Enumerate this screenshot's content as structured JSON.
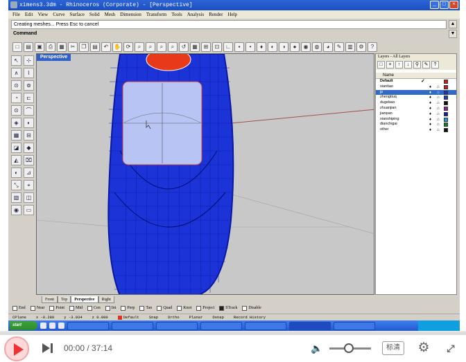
{
  "window": {
    "title": "ximens3.3dm - Rhinoceros (Corporate) - [Perspective]",
    "controls": [
      "_",
      "□",
      "×"
    ]
  },
  "menu": [
    "File",
    "Edit",
    "View",
    "Curve",
    "Surface",
    "Solid",
    "Mesh",
    "Dimension",
    "Transform",
    "Tools",
    "Analysis",
    "Render",
    "Help"
  ],
  "command": {
    "history": "Creating meshes... Press Esc to cancel",
    "prompt": "Command"
  },
  "toolbar_icons": [
    "new-file-icon",
    "open-icon",
    "save-icon",
    "print-icon",
    "import-icon",
    "cut-icon",
    "copy-icon",
    "paste-icon",
    "undo-icon",
    "pan-icon",
    "rotate-view-icon",
    "zoom-window-icon",
    "zoom-dynamic-icon",
    "zoom-extents-icon",
    "zoom-selected-icon",
    "undo-view-icon",
    "four-views-icon",
    "grid-icon",
    "cplane-icon",
    "ortho-icon",
    "snap-icon",
    "point-icon",
    "light-bulb-icon",
    "show-icon",
    "hide-icon",
    "shade-icon",
    "render-icon",
    "sphere-icon",
    "material-icon",
    "edit-icon",
    "layer-icon",
    "options-icon",
    "help-icon"
  ],
  "toolbar_glyphs": [
    "□",
    "▤",
    "▣",
    "⎙",
    "▦",
    "✂",
    "❐",
    "▤",
    "↶",
    "✋",
    "⟳",
    "⌕",
    "⌕",
    "⌕",
    "⌕",
    "↺",
    "▦",
    "⊞",
    "⊡",
    "∟",
    "▪",
    "•",
    "♦",
    "◐",
    "◑",
    "●",
    "◉",
    "◍",
    "◕",
    "✎",
    "▥",
    "⚙",
    "?"
  ],
  "left_tool_glyphs": [
    "↖",
    "⊹",
    "∧",
    "⌇",
    "⊙",
    "⊚",
    "◔",
    "⊏",
    "⊙",
    "⌒",
    "◈",
    "◐",
    "▦",
    "⊟",
    "◪",
    "◆",
    "◭",
    "⌧",
    "◐",
    "⊿",
    "⤡",
    "⌖",
    "▧",
    "◫",
    "◉",
    "▭"
  ],
  "viewport": {
    "title": "Perspective"
  },
  "view_tabs": [
    "Front",
    "Top",
    "Perspective",
    "Right"
  ],
  "view_tab_active": 2,
  "layers": {
    "title": "Layers - All Layers",
    "tool_glyphs": [
      "□",
      "×",
      "↑",
      "↓",
      "⚲",
      "✎",
      "?"
    ],
    "column_header": "Name",
    "rows": [
      {
        "name": "Default",
        "bold": true,
        "current": true,
        "selected": false,
        "color": "#c82020"
      },
      {
        "name": "xiantiao",
        "bold": false,
        "current": false,
        "selected": false,
        "color": "#c82020"
      },
      {
        "name": "jp",
        "bold": false,
        "current": false,
        "selected": true,
        "color": "#2030c0"
      },
      {
        "name": "zhengtiuq",
        "bold": false,
        "current": false,
        "selected": false,
        "color": "#2040d0"
      },
      {
        "name": "dugebao",
        "bold": false,
        "current": false,
        "selected": false,
        "color": "#101010"
      },
      {
        "name": "zhuanjian",
        "bold": false,
        "current": false,
        "selected": false,
        "color": "#9020a0"
      },
      {
        "name": "jianpan",
        "bold": false,
        "current": false,
        "selected": false,
        "color": "#1020b0"
      },
      {
        "name": "xianshiping",
        "bold": false,
        "current": false,
        "selected": false,
        "color": "#10a0d0"
      },
      {
        "name": "dianchigai",
        "bold": false,
        "current": false,
        "selected": false,
        "color": "#108020"
      },
      {
        "name": "other",
        "bold": false,
        "current": false,
        "selected": false,
        "color": "#101010"
      }
    ]
  },
  "snaps": [
    {
      "label": "End",
      "on": false
    },
    {
      "label": "Near",
      "on": false
    },
    {
      "label": "Point",
      "on": false
    },
    {
      "label": "Mid",
      "on": false
    },
    {
      "label": "Cen",
      "on": false
    },
    {
      "label": "Int",
      "on": false
    },
    {
      "label": "Perp",
      "on": false
    },
    {
      "label": "Tan",
      "on": false
    },
    {
      "label": "Quad",
      "on": false
    },
    {
      "label": "Knot",
      "on": false
    },
    {
      "label": "Project",
      "on": false
    },
    {
      "label": "STrack",
      "on": true
    },
    {
      "label": "Disable",
      "on": false
    }
  ],
  "status": {
    "cplane": "CPlane",
    "x": "x -0.280",
    "y": "y -3.934",
    "z": "z 0.000",
    "layer": "Default",
    "toggles": [
      "Snap",
      "Ortho",
      "Planar",
      "Osnap",
      "Record History"
    ]
  },
  "taskbar": {
    "start": "start",
    "tasks": [
      "",
      "",
      "",
      "",
      "",
      "",
      ""
    ],
    "active_index": 5
  },
  "player": {
    "time": "00:00 / 37:14",
    "quality": "标清",
    "progress": 0,
    "volume": 0.4
  }
}
